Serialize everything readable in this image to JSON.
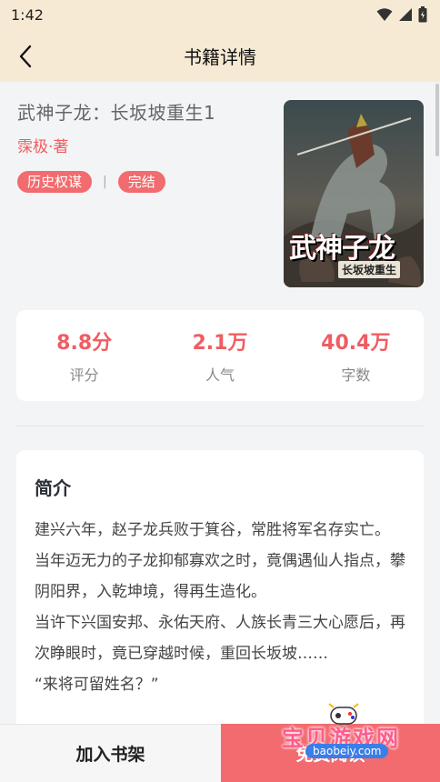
{
  "status_bar": {
    "time": "1:42"
  },
  "header": {
    "title": "书籍详情"
  },
  "book": {
    "title": "武神子龙：长坂坡重生1",
    "author": "霂极·著",
    "tags": [
      "历史权谋",
      "完结"
    ],
    "cover": {
      "title": "武神子龙",
      "subtitle": "长坂坡重生"
    }
  },
  "stats": [
    {
      "value": "8.8分",
      "label": "评分"
    },
    {
      "value": "2.1万",
      "label": "人气"
    },
    {
      "value": "40.4万",
      "label": "字数"
    }
  ],
  "intro": {
    "heading": "简介",
    "paragraphs": [
      "建兴六年，赵子龙兵败于箕谷，常胜将军名存实亡。",
      "当年迈无力的子龙抑郁寡欢之时，竟偶遇仙人指点，攀阴阳界，入乾坤境，得再生造化。",
      "当许下兴国安邦、永佑天府、人族长青三大心愿后，再次睁眼时，竟已穿越时候，重回长坂坡……",
      "“来将可留姓名？”"
    ]
  },
  "bottom_bar": {
    "add_shelf": "加入书架",
    "read": "免费阅读"
  },
  "watermark": {
    "text": "宝贝游戏网",
    "url": "baobeiy.com"
  }
}
